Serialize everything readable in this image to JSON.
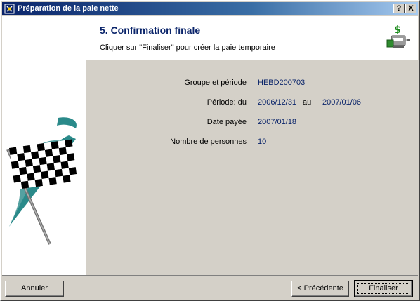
{
  "window": {
    "title": "Préparation de la paie nette"
  },
  "titlebar_buttons": {
    "help": "?",
    "close": "X"
  },
  "header": {
    "title": "5. Confirmation finale",
    "subtitle": "Cliquer sur \"Finaliser\" pour créer la paie temporaire"
  },
  "fields": {
    "groupe": {
      "label": "Groupe et période",
      "value": "HEBD200703"
    },
    "periode": {
      "label": "Période: du",
      "from": "2006/12/31",
      "sep": "au",
      "to": "2007/01/06"
    },
    "date_payee": {
      "label": "Date payée",
      "value": "2007/01/18"
    },
    "nombre": {
      "label": "Nombre de personnes",
      "value": "10"
    }
  },
  "buttons": {
    "cancel": "Annuler",
    "previous": "< Précédente",
    "finish": "Finaliser"
  },
  "colors": {
    "title_bar": "#0a246a",
    "accent_text": "#0a246a",
    "face": "#d4d0c8",
    "flag_swoosh": "#2a8a8a"
  },
  "icons": {
    "app": "wizard-icon",
    "header": "money-machine-icon",
    "wizard_art": "checkered-flag-illustration"
  }
}
